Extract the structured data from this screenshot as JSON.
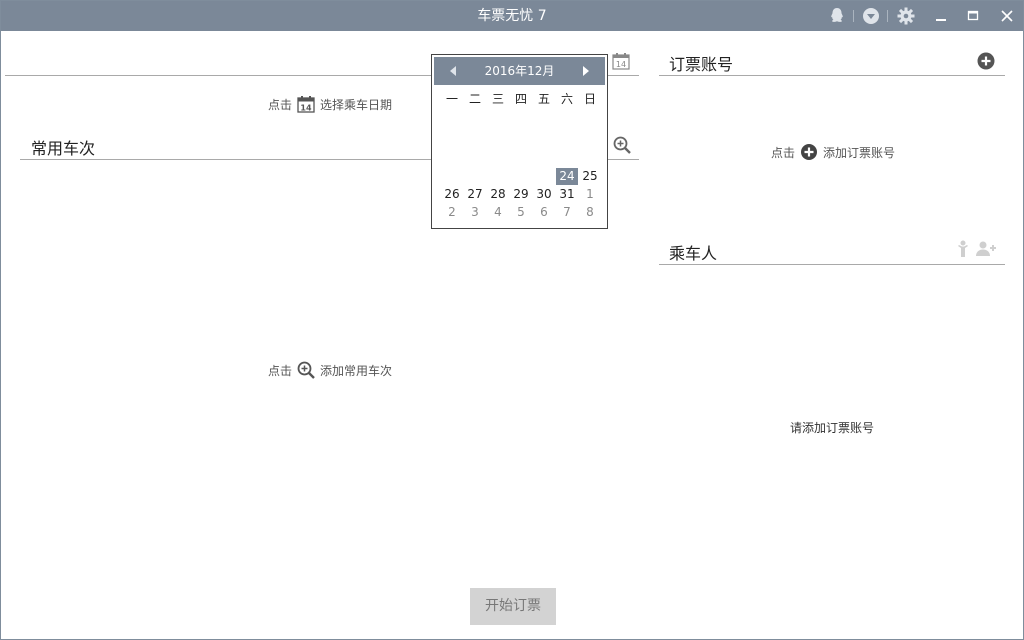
{
  "window": {
    "title": "车票无忧 7"
  },
  "titlebar": {
    "icons": [
      "qq-icon",
      "dropdown-icon",
      "settings-icon",
      "minimize-icon",
      "maximize-icon",
      "close-icon"
    ]
  },
  "date_section": {
    "hint_prefix": "点击",
    "hint_action": "选择乘车日期",
    "calendar_icon_day": "14"
  },
  "frequent_trains": {
    "title": "常用车次",
    "hint_prefix": "点击",
    "hint_action": "添加常用车次"
  },
  "calendar": {
    "month_label": "2016年12月",
    "weekdays": [
      "一",
      "二",
      "三",
      "四",
      "五",
      "六",
      "日"
    ],
    "week4": [
      "",
      "",
      "",
      "",
      "",
      "24",
      "25"
    ],
    "week5": [
      "26",
      "27",
      "28",
      "29",
      "30",
      "31",
      "1"
    ],
    "week6": [
      "2",
      "3",
      "4",
      "5",
      "6",
      "7",
      "8"
    ],
    "selected_day": "24"
  },
  "accounts": {
    "title": "订票账号",
    "hint_prefix": "点击",
    "hint_action": "添加订票账号"
  },
  "passengers": {
    "title": "乘车人",
    "empty_message": "请添加订票账号"
  },
  "footer": {
    "start_button": "开始订票"
  },
  "colors": {
    "accent": "#7b8898",
    "rule": "#a9a9a9",
    "button_bg": "#d3d3d3"
  }
}
